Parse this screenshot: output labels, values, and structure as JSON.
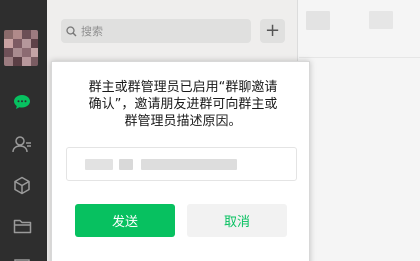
{
  "search": {
    "placeholder": "搜索"
  },
  "list": {
    "add_label": "+"
  },
  "dialog": {
    "message_lines": [
      "群主或群管理员已启用“群聊邀请",
      "确认”，邀请朋友进群可向群主或",
      "群管理员描述原因。"
    ],
    "send_label": "发送",
    "cancel_label": "取消"
  },
  "colors": {
    "sidebar": "#2e2e2e",
    "accent": "#07c160",
    "list_bg": "#efeeed",
    "dialog_bg": "#ffffff"
  },
  "icons": [
    "chat-icon",
    "contacts-icon",
    "favorites-cube-icon",
    "files-folder-icon",
    "search-icon"
  ]
}
